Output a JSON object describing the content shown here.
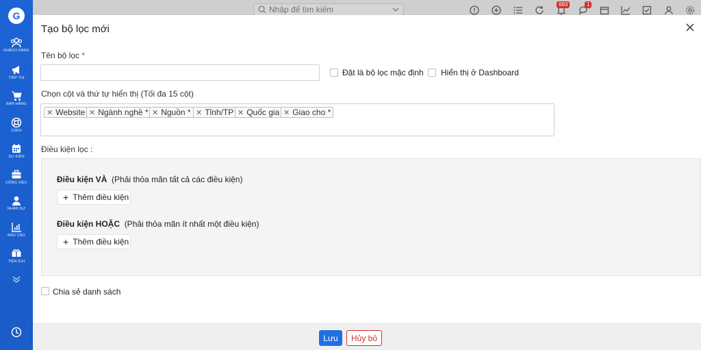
{
  "sidebar": {
    "logo_letter": "G",
    "items": [
      {
        "label": "KHÁCH HÀNG",
        "icon": "customers-icon"
      },
      {
        "label": "TIẾP THỊ",
        "icon": "megaphone-icon"
      },
      {
        "label": "BÁN HÀNG",
        "icon": "cart-icon"
      },
      {
        "label": "CSKH",
        "icon": "lifebuoy-icon"
      },
      {
        "label": "SỰ KIỆN",
        "icon": "calendar-icon"
      },
      {
        "label": "CÔNG VIỆC",
        "icon": "briefcase-icon"
      },
      {
        "label": "NHÂN SỰ",
        "icon": "person-icon"
      },
      {
        "label": "BÁO CÁO",
        "icon": "report-icon"
      },
      {
        "label": "TIỆN ÍCH",
        "icon": "utilities-icon"
      }
    ]
  },
  "topbar": {
    "search_placeholder": "Nhập để tìm kiếm",
    "notifications_badge": "693",
    "messages_badge": "1"
  },
  "modal": {
    "title": "Tạo bộ lọc mới",
    "name_label": "Tên bộ lọc",
    "required_mark": "*",
    "name_value": "",
    "default_filter_label": "Đặt là bộ lọc mặc định",
    "show_dashboard_label": "Hiển thị ở Dashboard",
    "columns_label": "Chọn cột và thứ tự hiển thị (Tối đa 15 cột)",
    "columns": [
      "Website",
      "Ngành nghề *",
      "Nguồn *",
      "Tỉnh/TP",
      "Quốc gia",
      "Giao cho *"
    ],
    "conditions_label": "Điều kiện lọc :",
    "and_title": "Điều kiện VÀ",
    "and_desc": "(Phải thỏa mãn tất cả các điều kiện)",
    "or_title": "Điều kiện HOẶC",
    "or_desc": "(Phải thỏa mãn ít nhất một điều kiện)",
    "add_condition_label": "Thêm điều kiện",
    "share_label": "Chia sẻ danh sách",
    "save_label": "Lưu",
    "cancel_label": "Hủy bỏ"
  },
  "colors": {
    "sidebar": "#1c63d5",
    "primary_button": "#1f6fe0",
    "danger": "#d32f2f"
  }
}
